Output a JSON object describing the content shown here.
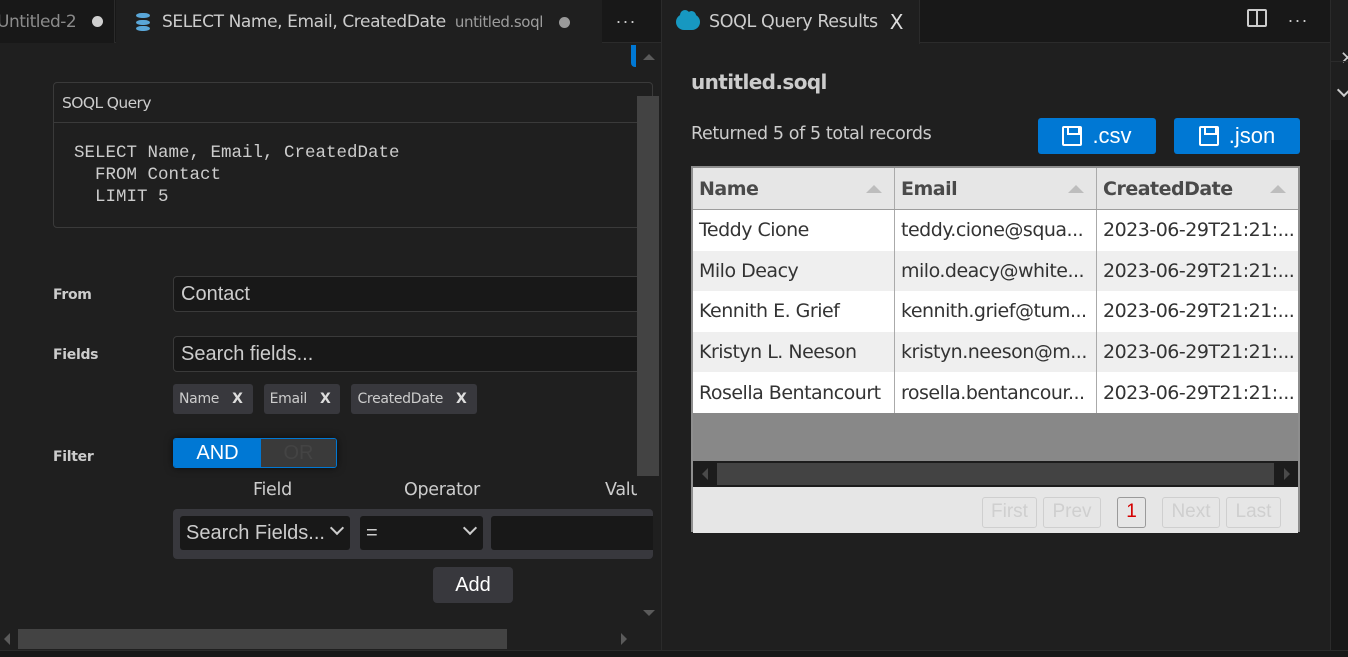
{
  "left_editor": {
    "tabs": [
      {
        "label": "Untitled-2",
        "modified": true,
        "active": false
      },
      {
        "label": "SELECT Name, Email, CreatedDate",
        "description": "untitled.soql",
        "modified": true,
        "active": true,
        "icon": "database-icon"
      }
    ],
    "more_actions": "···",
    "query_box": {
      "title": "SOQL Query",
      "text": "SELECT Name, Email, CreatedDate\n  FROM Contact\n  LIMIT 5"
    },
    "from": {
      "label": "From",
      "value": "Contact"
    },
    "fields": {
      "label": "Fields",
      "placeholder": "Search fields...",
      "selected": [
        {
          "label": "Name",
          "remove": "X"
        },
        {
          "label": "Email",
          "remove": "X"
        },
        {
          "label": "CreatedDate",
          "remove": "X"
        }
      ]
    },
    "filter": {
      "label": "Filter",
      "toggle": {
        "options": [
          "AND",
          "OR"
        ],
        "selected": "AND"
      },
      "columns": [
        "Field",
        "Operator",
        "Value"
      ],
      "row": {
        "field": "Search Fields...",
        "operator": "=",
        "value": ""
      },
      "add_label": "Add"
    }
  },
  "right_editor": {
    "tab": {
      "label": "SOQL Query Results",
      "close": "X",
      "icon": "salesforce-cloud-icon"
    },
    "more_actions": "···",
    "title": "untitled.soql",
    "summary": "Returned 5 of 5 total records",
    "buttons": {
      "csv": ".csv",
      "json": ".json"
    },
    "table": {
      "columns": [
        "Name",
        "Email",
        "CreatedDate"
      ],
      "rows": [
        [
          "Teddy Cione",
          "teddy.cione@squa...",
          "2023-06-29T21:21:..."
        ],
        [
          "Milo Deacy",
          "milo.deacy@white...",
          "2023-06-29T21:21:..."
        ],
        [
          "Kennith E. Grief",
          "kennith.grief@tum...",
          "2023-06-29T21:21:..."
        ],
        [
          "Kristyn L. Neeson",
          "kristyn.neeson@m...",
          "2023-06-29T21:21:..."
        ],
        [
          "Rosella Bentancourt",
          "rosella.bentancour...",
          "2023-06-29T21:21:..."
        ]
      ]
    },
    "pager": {
      "first": "First",
      "prev": "Prev",
      "current": "1",
      "next": "Next",
      "last": "Last"
    }
  },
  "colors": {
    "accent": "#0078d4",
    "background": "#1f1f1f",
    "salesforce": "#1798c1"
  }
}
